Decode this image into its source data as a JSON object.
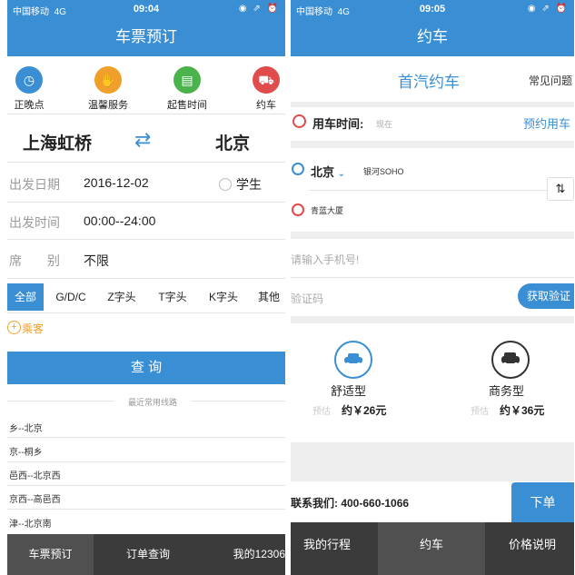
{
  "left": {
    "status": {
      "carrier": "中国移动",
      "network": "4G",
      "time": "09:04",
      "icons": "◉ ⇗ ⏰"
    },
    "title": "车票预订",
    "shortcuts": [
      {
        "label": "正晚点",
        "icon": "clock-icon",
        "color": "#3a8fd4",
        "glyph": "◷"
      },
      {
        "label": "温馨服务",
        "icon": "handshake-icon",
        "color": "#f0a02a",
        "glyph": "✋"
      },
      {
        "label": "起售时间",
        "icon": "ticket-icon",
        "color": "#4bb34b",
        "glyph": "▤"
      },
      {
        "label": "约车",
        "icon": "car-icon",
        "color": "#e04b4b",
        "glyph": "🚗"
      }
    ],
    "from_station": "上海虹桥",
    "to_station": "北京",
    "swap_glyph": "⇄",
    "depart_date_label": "出发日期",
    "depart_date_value": "2016-12-02",
    "student_label": "学生",
    "depart_time_label": "出发时间",
    "depart_time_value": "00:00--24:00",
    "seat_label": "席　　别",
    "seat_value": "不限",
    "train_tabs": [
      "全部",
      "G/D/C",
      "Z字头",
      "T字头",
      "K字头",
      "其他"
    ],
    "passenger_label": "乘客",
    "query_button": "查 询",
    "recent_title": "最近常用线路",
    "recent_routes": [
      "乡--北京",
      "京--桐乡",
      "邑西--北京西",
      "京西--高邑西",
      "津--北京南"
    ],
    "bottom_nav": [
      "车票预订",
      "订单查询",
      "我的12306"
    ]
  },
  "right": {
    "status": {
      "carrier": "中国移动",
      "network": "4G",
      "time": "09:05",
      "icons": "◉ ⇗ ⏰"
    },
    "title": "约车",
    "subheader_title": "首汽约车",
    "faq": "常见问题",
    "time_label": "用车时间:",
    "time_value": "现在",
    "book_ahead": "预约用车",
    "city": "北京",
    "start_location": "银河SOHO",
    "destination": "青蓝大厦",
    "phone_placeholder": "请输入手机号!",
    "code_placeholder": "验证码",
    "get_code": "获取验证",
    "car_types": [
      {
        "name": "舒适型",
        "est_label": "预估",
        "price": "约￥26元"
      },
      {
        "name": "商务型",
        "est_label": "预估",
        "price": "约￥36元"
      }
    ],
    "contact": "联系我们:  400-660-1066",
    "order_button": "下单",
    "bottom_nav": [
      "我的行程",
      "约车",
      "价格说明"
    ]
  },
  "colors": {
    "accent": "#3a8fd4",
    "bottom_bar": "#3b3b3b"
  }
}
